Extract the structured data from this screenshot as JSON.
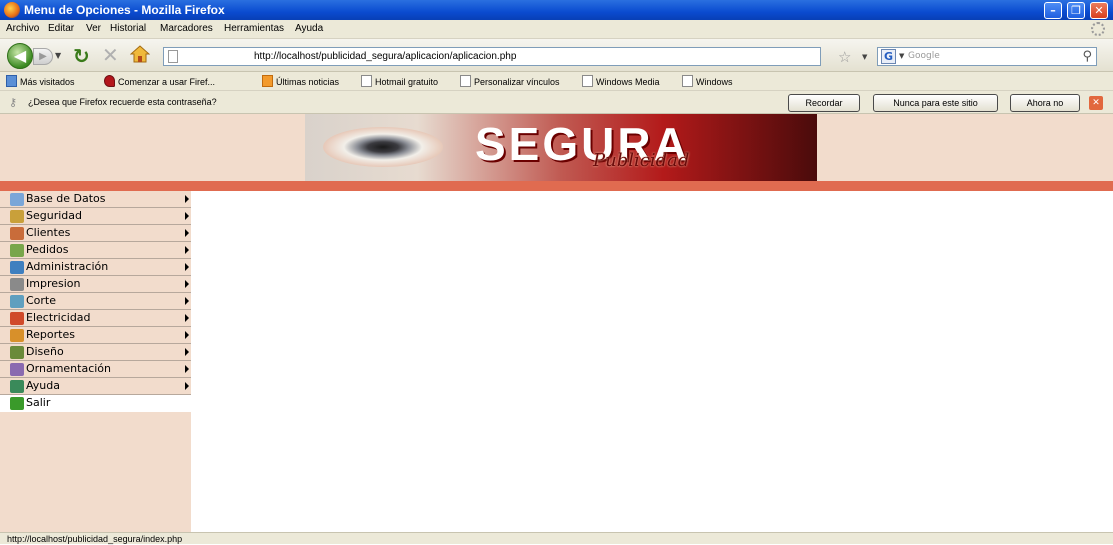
{
  "window": {
    "title": "Menu de Opciones - Mozilla Firefox"
  },
  "menubar": {
    "items": [
      {
        "label": "Archivo"
      },
      {
        "label": "Editar"
      },
      {
        "label": "Ver"
      },
      {
        "label": "Historial"
      },
      {
        "label": "Marcadores"
      },
      {
        "label": "Herramientas"
      },
      {
        "label": "Ayuda"
      }
    ]
  },
  "navbar": {
    "url": "http://localhost/publicidad_segura/aplicacion/aplicacion.php",
    "search_placeholder": "Google"
  },
  "bookmarks": [
    {
      "label": "Más visitados",
      "icon": "most-visited-icon"
    },
    {
      "label": "Comenzar a usar Firef...",
      "icon": "firefox-start-icon"
    },
    {
      "label": "Últimas noticias",
      "icon": "rss-icon"
    },
    {
      "label": "Hotmail gratuito",
      "icon": "page-icon"
    },
    {
      "label": "Personalizar vínculos",
      "icon": "page-icon"
    },
    {
      "label": "Windows Media",
      "icon": "page-icon"
    },
    {
      "label": "Windows",
      "icon": "page-icon"
    }
  ],
  "password_bar": {
    "question": "¿Desea que Firefox recuerde esta contraseña?",
    "remember": "Recordar",
    "never": "Nunca para este sitio",
    "not_now": "Ahora no"
  },
  "banner": {
    "title": "SEGURA",
    "subtitle": "Publicidad"
  },
  "sidebar": {
    "items": [
      {
        "label": "Base de Datos",
        "icon": "database-icon",
        "color": "#7aa6d8"
      },
      {
        "label": "Seguridad",
        "icon": "security-icon",
        "color": "#c9a03a"
      },
      {
        "label": "Clientes",
        "icon": "clients-icon",
        "color": "#c96c3a"
      },
      {
        "label": "Pedidos",
        "icon": "orders-icon",
        "color": "#78a64a"
      },
      {
        "label": "Administración",
        "icon": "administration-icon",
        "color": "#3f7fbf"
      },
      {
        "label": "Impresion",
        "icon": "printer-icon",
        "color": "#8a8a8a"
      },
      {
        "label": "Corte",
        "icon": "cut-icon",
        "color": "#5f9fbf"
      },
      {
        "label": "Electricidad",
        "icon": "electricity-icon",
        "color": "#d04a2a"
      },
      {
        "label": "Reportes",
        "icon": "reports-icon",
        "color": "#d8902a"
      },
      {
        "label": "Diseño",
        "icon": "design-icon",
        "color": "#6a8a3a"
      },
      {
        "label": "Ornamentación",
        "icon": "ornament-icon",
        "color": "#8a6ab0"
      },
      {
        "label": "Ayuda",
        "icon": "help-icon",
        "color": "#3a8a5a"
      }
    ],
    "exit": {
      "label": "Salir",
      "icon": "exit-arrow-icon",
      "color": "#3a9a2a"
    }
  },
  "statusbar": {
    "text": "http://localhost/publicidad_segura/index.php"
  }
}
